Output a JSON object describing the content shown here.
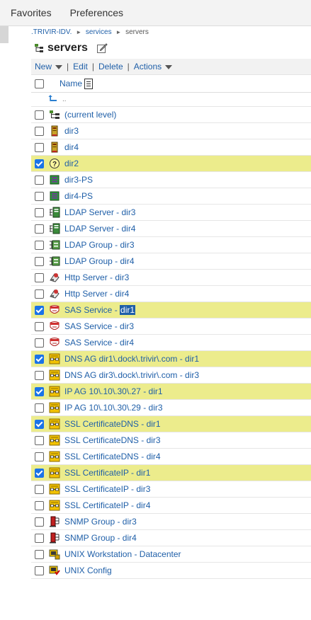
{
  "menu": {
    "favorites": "Favorites",
    "preferences": "Preferences"
  },
  "breadcrumb": {
    "root": ".TRIVIR-IDV.",
    "sep1": "►",
    "mid": "services",
    "sep2": "►",
    "current": "servers"
  },
  "page": {
    "title": "servers"
  },
  "toolbar": {
    "new": "New",
    "edit": "Edit",
    "delete": "Delete",
    "actions": "Actions",
    "pipe": "|"
  },
  "table": {
    "header_name": "Name",
    "up_link": "..",
    "rows": [
      {
        "label": "(current level)",
        "icon": "tree-icon",
        "checked": false
      },
      {
        "label": "dir3",
        "icon": "server-icon",
        "checked": false
      },
      {
        "label": "dir4",
        "icon": "server-icon",
        "checked": false
      },
      {
        "label": "dir2",
        "icon": "question-icon",
        "checked": true
      },
      {
        "label": "dir3-PS",
        "icon": "printer-server-icon",
        "checked": false
      },
      {
        "label": "dir4-PS",
        "icon": "printer-server-icon",
        "checked": false
      },
      {
        "label": "LDAP Server - dir3",
        "icon": "ldap-server-icon",
        "checked": false
      },
      {
        "label": "LDAP Server - dir4",
        "icon": "ldap-server-icon",
        "checked": false
      },
      {
        "label": "LDAP Group - dir3",
        "icon": "ldap-group-icon",
        "checked": false
      },
      {
        "label": "LDAP Group - dir4",
        "icon": "ldap-group-icon",
        "checked": false
      },
      {
        "label": "Http Server - dir3",
        "icon": "http-server-icon",
        "checked": false
      },
      {
        "label": "Http Server - dir4",
        "icon": "http-server-icon",
        "checked": false
      },
      {
        "label": "SAS Service - ",
        "label_highlight": "dir1",
        "icon": "sas-service-icon",
        "checked": true
      },
      {
        "label": "SAS Service - dir3",
        "icon": "sas-service-icon",
        "checked": false
      },
      {
        "label": "SAS Service - dir4",
        "icon": "sas-service-icon",
        "checked": false
      },
      {
        "label": "DNS AG dir1\\.dock\\.trivir\\.com - dir1",
        "icon": "ag-icon",
        "checked": true
      },
      {
        "label": "DNS AG dir3\\.dock\\.trivir\\.com - dir3",
        "icon": "ag-icon",
        "checked": false
      },
      {
        "label": "IP AG 10\\.10\\.30\\.27 - dir1",
        "icon": "ag-icon",
        "checked": true
      },
      {
        "label": "IP AG 10\\.10\\.30\\.29 - dir3",
        "icon": "ag-icon",
        "checked": false
      },
      {
        "label": "SSL CertificateDNS - dir1",
        "icon": "ag-icon",
        "checked": true
      },
      {
        "label": "SSL CertificateDNS - dir3",
        "icon": "ag-icon",
        "checked": false
      },
      {
        "label": "SSL CertificateDNS - dir4",
        "icon": "ag-icon",
        "checked": false
      },
      {
        "label": "SSL CertificateIP - dir1",
        "icon": "ag-icon",
        "checked": true
      },
      {
        "label": "SSL CertificateIP - dir3",
        "icon": "ag-icon",
        "checked": false
      },
      {
        "label": "SSL CertificateIP - dir4",
        "icon": "ag-icon",
        "checked": false
      },
      {
        "label": "SNMP Group - dir3",
        "icon": "snmp-group-icon",
        "checked": false
      },
      {
        "label": "SNMP Group - dir4",
        "icon": "snmp-group-icon",
        "checked": false
      },
      {
        "label": "UNIX Workstation - Datacenter",
        "icon": "unix-workstation-icon",
        "checked": false
      },
      {
        "label": "UNIX Config",
        "icon": "unix-config-icon",
        "checked": false
      }
    ]
  },
  "colors": {
    "link": "#1f5fa8",
    "selected_row": "#ecec8c",
    "checkbox": "#1a73e8"
  }
}
